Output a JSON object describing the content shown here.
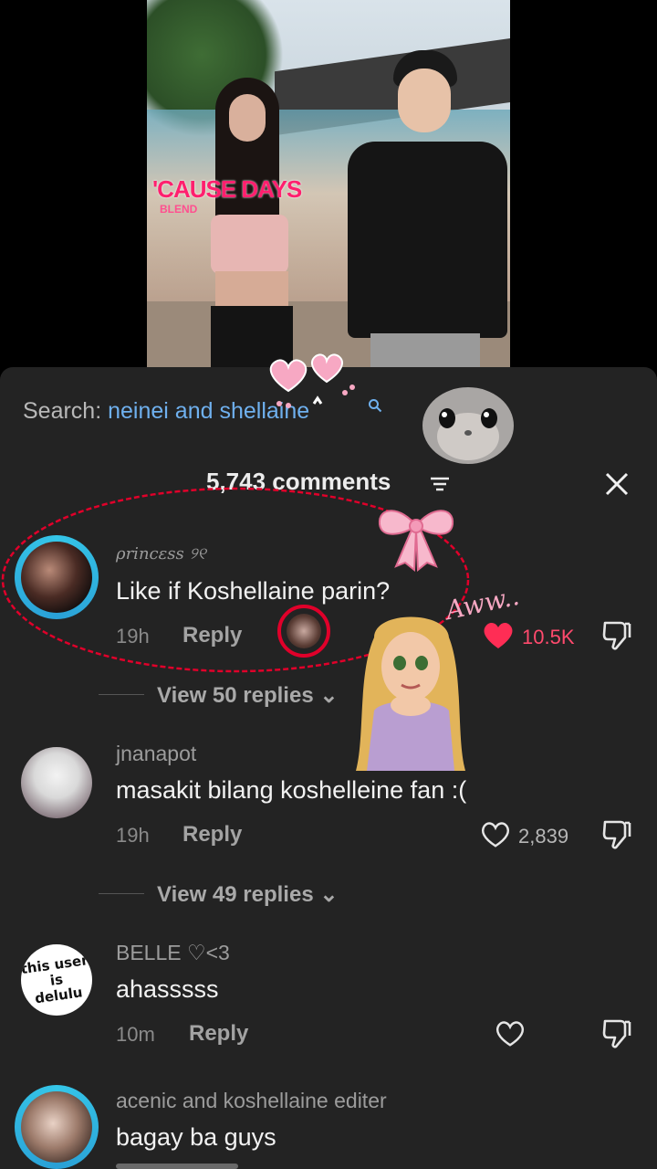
{
  "video": {
    "lyric_text": "'CAUSE DAYS",
    "lyric_sub": "BLEND"
  },
  "search": {
    "prefix": "Search:",
    "query": "neinei and shellaine"
  },
  "comments_header": {
    "count_label": "5,743 comments"
  },
  "stickers": {
    "aww_text": "Aww.."
  },
  "comments": [
    {
      "username": "ρrincεss ୨୧",
      "text": "Like if Koshellaine parin?",
      "time": "19h",
      "reply_label": "Reply",
      "likes": "10.5K",
      "liked": true,
      "view_replies": "View 50 replies"
    },
    {
      "username": "jnanapot",
      "text": "masakit bilang koshelleine fan :(",
      "time": "19h",
      "reply_label": "Reply",
      "likes": "2,839",
      "liked": false,
      "view_replies": "View 49 replies"
    },
    {
      "username": "BELLE ♡<3",
      "text": "ahasssss",
      "time": "10m",
      "reply_label": "Reply",
      "likes": "",
      "liked": false,
      "avatar_text_1": "this user is",
      "avatar_text_2": "delulu"
    },
    {
      "username": "acenic and koshellaine editer",
      "text": "bagay ba guys"
    }
  ],
  "colors": {
    "sheet_bg": "#232323",
    "like_red": "#ff2d55",
    "search_blue": "#6fb0ee",
    "story_ring_cyan": "#35c6e8",
    "circle_annotation": "#e0002a"
  }
}
